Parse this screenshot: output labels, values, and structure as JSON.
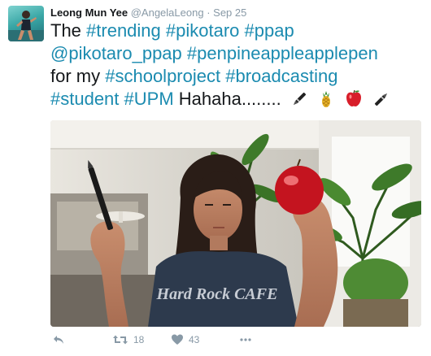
{
  "tweet": {
    "author_name": "Leong Mun Yee",
    "handle": "@AngelaLeong",
    "separator": "·",
    "date": "Sep 25",
    "lines": [
      [
        {
          "text": "The ",
          "type": "text"
        },
        {
          "text": "#trending",
          "type": "hashtag"
        },
        {
          "text": " ",
          "type": "text"
        },
        {
          "text": "#pikotaro",
          "type": "hashtag"
        },
        {
          "text": " ",
          "type": "text"
        },
        {
          "text": "#ppap",
          "type": "hashtag"
        }
      ],
      [
        {
          "text": "@pikotaro_ppap",
          "type": "hashtag"
        },
        {
          "text": " ",
          "type": "text"
        },
        {
          "text": "#penpineappleapplepen",
          "type": "hashtag"
        }
      ],
      [
        {
          "text": "for my ",
          "type": "text"
        },
        {
          "text": "#schoolproject",
          "type": "hashtag"
        },
        {
          "text": " ",
          "type": "text"
        },
        {
          "text": "#broadcasting",
          "type": "hashtag"
        }
      ],
      [
        {
          "text": "#student",
          "type": "hashtag"
        },
        {
          "text": " ",
          "type": "text"
        },
        {
          "text": "#UPM",
          "type": "hashtag"
        },
        {
          "text": " Hahaha........",
          "type": "text"
        }
      ]
    ],
    "emojis": [
      "pen-icon",
      "pineapple-icon",
      "apple-icon",
      "pen-icon"
    ],
    "media_printed_text": "Hard Rock CAFE",
    "actions": {
      "reply_icon": "reply-icon",
      "retweet_icon": "retweet-icon",
      "retweet_count": "18",
      "like_icon": "heart-icon",
      "like_count": "43",
      "more_icon": "more-icon"
    },
    "colors": {
      "hashtag": "#1b8bb0",
      "text": "#14171a",
      "muted": "#8899a6"
    }
  }
}
